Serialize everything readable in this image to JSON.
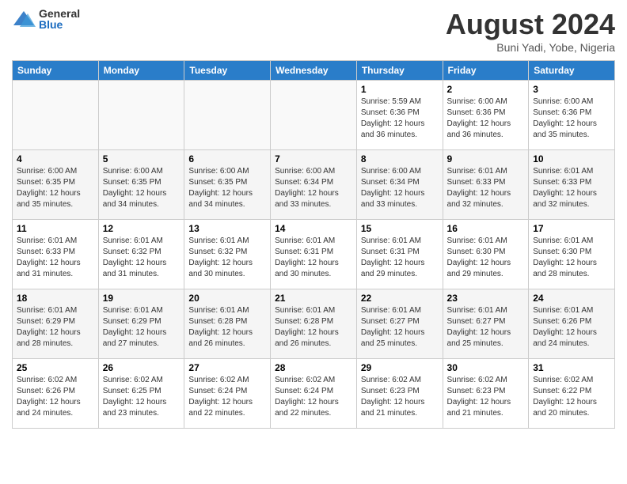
{
  "logo": {
    "general": "General",
    "blue": "Blue"
  },
  "header": {
    "month_year": "August 2024",
    "location": "Buni Yadi, Yobe, Nigeria"
  },
  "weekdays": [
    "Sunday",
    "Monday",
    "Tuesday",
    "Wednesday",
    "Thursday",
    "Friday",
    "Saturday"
  ],
  "weeks": [
    [
      {
        "day": "",
        "empty": true
      },
      {
        "day": "",
        "empty": true
      },
      {
        "day": "",
        "empty": true
      },
      {
        "day": "",
        "empty": true
      },
      {
        "day": "1",
        "sunrise": "Sunrise: 5:59 AM",
        "sunset": "Sunset: 6:36 PM",
        "daylight": "Daylight: 12 hours and 36 minutes."
      },
      {
        "day": "2",
        "sunrise": "Sunrise: 6:00 AM",
        "sunset": "Sunset: 6:36 PM",
        "daylight": "Daylight: 12 hours and 36 minutes."
      },
      {
        "day": "3",
        "sunrise": "Sunrise: 6:00 AM",
        "sunset": "Sunset: 6:36 PM",
        "daylight": "Daylight: 12 hours and 35 minutes."
      }
    ],
    [
      {
        "day": "4",
        "sunrise": "Sunrise: 6:00 AM",
        "sunset": "Sunset: 6:35 PM",
        "daylight": "Daylight: 12 hours and 35 minutes."
      },
      {
        "day": "5",
        "sunrise": "Sunrise: 6:00 AM",
        "sunset": "Sunset: 6:35 PM",
        "daylight": "Daylight: 12 hours and 34 minutes."
      },
      {
        "day": "6",
        "sunrise": "Sunrise: 6:00 AM",
        "sunset": "Sunset: 6:35 PM",
        "daylight": "Daylight: 12 hours and 34 minutes."
      },
      {
        "day": "7",
        "sunrise": "Sunrise: 6:00 AM",
        "sunset": "Sunset: 6:34 PM",
        "daylight": "Daylight: 12 hours and 33 minutes."
      },
      {
        "day": "8",
        "sunrise": "Sunrise: 6:00 AM",
        "sunset": "Sunset: 6:34 PM",
        "daylight": "Daylight: 12 hours and 33 minutes."
      },
      {
        "day": "9",
        "sunrise": "Sunrise: 6:01 AM",
        "sunset": "Sunset: 6:33 PM",
        "daylight": "Daylight: 12 hours and 32 minutes."
      },
      {
        "day": "10",
        "sunrise": "Sunrise: 6:01 AM",
        "sunset": "Sunset: 6:33 PM",
        "daylight": "Daylight: 12 hours and 32 minutes."
      }
    ],
    [
      {
        "day": "11",
        "sunrise": "Sunrise: 6:01 AM",
        "sunset": "Sunset: 6:33 PM",
        "daylight": "Daylight: 12 hours and 31 minutes."
      },
      {
        "day": "12",
        "sunrise": "Sunrise: 6:01 AM",
        "sunset": "Sunset: 6:32 PM",
        "daylight": "Daylight: 12 hours and 31 minutes."
      },
      {
        "day": "13",
        "sunrise": "Sunrise: 6:01 AM",
        "sunset": "Sunset: 6:32 PM",
        "daylight": "Daylight: 12 hours and 30 minutes."
      },
      {
        "day": "14",
        "sunrise": "Sunrise: 6:01 AM",
        "sunset": "Sunset: 6:31 PM",
        "daylight": "Daylight: 12 hours and 30 minutes."
      },
      {
        "day": "15",
        "sunrise": "Sunrise: 6:01 AM",
        "sunset": "Sunset: 6:31 PM",
        "daylight": "Daylight: 12 hours and 29 minutes."
      },
      {
        "day": "16",
        "sunrise": "Sunrise: 6:01 AM",
        "sunset": "Sunset: 6:30 PM",
        "daylight": "Daylight: 12 hours and 29 minutes."
      },
      {
        "day": "17",
        "sunrise": "Sunrise: 6:01 AM",
        "sunset": "Sunset: 6:30 PM",
        "daylight": "Daylight: 12 hours and 28 minutes."
      }
    ],
    [
      {
        "day": "18",
        "sunrise": "Sunrise: 6:01 AM",
        "sunset": "Sunset: 6:29 PM",
        "daylight": "Daylight: 12 hours and 28 minutes."
      },
      {
        "day": "19",
        "sunrise": "Sunrise: 6:01 AM",
        "sunset": "Sunset: 6:29 PM",
        "daylight": "Daylight: 12 hours and 27 minutes."
      },
      {
        "day": "20",
        "sunrise": "Sunrise: 6:01 AM",
        "sunset": "Sunset: 6:28 PM",
        "daylight": "Daylight: 12 hours and 26 minutes."
      },
      {
        "day": "21",
        "sunrise": "Sunrise: 6:01 AM",
        "sunset": "Sunset: 6:28 PM",
        "daylight": "Daylight: 12 hours and 26 minutes."
      },
      {
        "day": "22",
        "sunrise": "Sunrise: 6:01 AM",
        "sunset": "Sunset: 6:27 PM",
        "daylight": "Daylight: 12 hours and 25 minutes."
      },
      {
        "day": "23",
        "sunrise": "Sunrise: 6:01 AM",
        "sunset": "Sunset: 6:27 PM",
        "daylight": "Daylight: 12 hours and 25 minutes."
      },
      {
        "day": "24",
        "sunrise": "Sunrise: 6:01 AM",
        "sunset": "Sunset: 6:26 PM",
        "daylight": "Daylight: 12 hours and 24 minutes."
      }
    ],
    [
      {
        "day": "25",
        "sunrise": "Sunrise: 6:02 AM",
        "sunset": "Sunset: 6:26 PM",
        "daylight": "Daylight: 12 hours and 24 minutes."
      },
      {
        "day": "26",
        "sunrise": "Sunrise: 6:02 AM",
        "sunset": "Sunset: 6:25 PM",
        "daylight": "Daylight: 12 hours and 23 minutes."
      },
      {
        "day": "27",
        "sunrise": "Sunrise: 6:02 AM",
        "sunset": "Sunset: 6:24 PM",
        "daylight": "Daylight: 12 hours and 22 minutes."
      },
      {
        "day": "28",
        "sunrise": "Sunrise: 6:02 AM",
        "sunset": "Sunset: 6:24 PM",
        "daylight": "Daylight: 12 hours and 22 minutes."
      },
      {
        "day": "29",
        "sunrise": "Sunrise: 6:02 AM",
        "sunset": "Sunset: 6:23 PM",
        "daylight": "Daylight: 12 hours and 21 minutes."
      },
      {
        "day": "30",
        "sunrise": "Sunrise: 6:02 AM",
        "sunset": "Sunset: 6:23 PM",
        "daylight": "Daylight: 12 hours and 21 minutes."
      },
      {
        "day": "31",
        "sunrise": "Sunrise: 6:02 AM",
        "sunset": "Sunset: 6:22 PM",
        "daylight": "Daylight: 12 hours and 20 minutes."
      }
    ]
  ]
}
